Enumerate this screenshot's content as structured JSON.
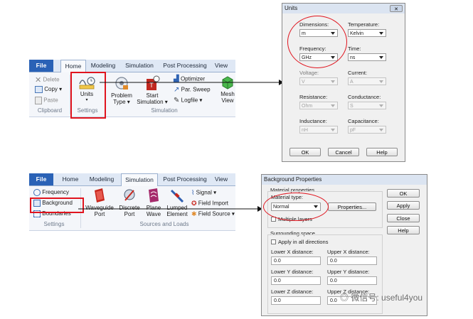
{
  "ribbon1": {
    "tabs": [
      "File",
      "Home",
      "Modeling",
      "Simulation",
      "Post Processing",
      "View"
    ],
    "clipboard": {
      "delete": "Delete",
      "copy": "Copy",
      "paste": "Paste",
      "group": "Clipboard"
    },
    "settings": {
      "units": "Units",
      "group": "Settings"
    },
    "simulation": {
      "problem_type_1": "Problem",
      "problem_type_2": "Type",
      "start_1": "Start",
      "start_2": "Simulation",
      "optimizer": "Optimizer",
      "par_sweep": "Par. Sweep",
      "logfile": "Logfile",
      "mesh_1": "Mesh",
      "mesh_2": "View",
      "group": "Simulation"
    }
  },
  "units_dialog": {
    "title": "Units",
    "dimensions_label": "Dimensions:",
    "dimensions_value": "m",
    "temperature_label": "Temperature:",
    "temperature_value": "Kelvin",
    "frequency_label": "Frequency:",
    "frequency_value": "GHz",
    "time_label": "Time:",
    "time_value": "ns",
    "voltage_label": "Voltage:",
    "voltage_value": "V",
    "current_label": "Current:",
    "current_value": "A",
    "resistance_label": "Resistance:",
    "resistance_value": "Ohm",
    "conductance_label": "Conductance:",
    "conductance_value": "S",
    "inductance_label": "Inductance:",
    "inductance_value": "nH",
    "capacitance_label": "Capacitance:",
    "capacitance_value": "pF",
    "ok": "OK",
    "cancel": "Cancel",
    "help": "Help"
  },
  "ribbon2": {
    "tabs": [
      "File",
      "Home",
      "Modeling",
      "Simulation",
      "Post Processing",
      "View"
    ],
    "settings": {
      "frequency": "Frequency",
      "background": "Background",
      "boundaries": "Boundaries",
      "group": "Settings"
    },
    "sources": {
      "waveguide_1": "Waveguide",
      "waveguide_2": "Port",
      "discrete_1": "Discrete",
      "discrete_2": "Port",
      "plane_1": "Plane",
      "plane_2": "Wave",
      "lumped_1": "Lumped",
      "lumped_2": "Element",
      "signal": "Signal",
      "field_import": "Field Import",
      "field_source": "Field Source",
      "group": "Sources and Loads"
    }
  },
  "bg_dialog": {
    "title": "Background Properties",
    "material_group": "Material properties",
    "material_type_label": "Material type:",
    "material_type_value": "Normal",
    "properties_button": "Properties...",
    "multiple_layers": "Multiple layers",
    "surrounding_group": "Surrounding space",
    "apply_all": "Apply in all directions",
    "lower_x": "Lower X distance:",
    "upper_x": "Upper X distance:",
    "lower_y": "Lower Y distance:",
    "upper_y": "Upper Y distance:",
    "lower_z": "Lower Z distance:",
    "upper_z": "Upper Z distance:",
    "lower_x_val": "0.0",
    "upper_x_val": "0.0",
    "lower_y_val": "0.0",
    "upper_y_val": "0.0",
    "lower_z_val": "0.0",
    "upper_z_val": "0.0",
    "ok": "OK",
    "apply": "Apply",
    "close": "Close",
    "help": "Help"
  },
  "watermark": "微信号: useful4you"
}
